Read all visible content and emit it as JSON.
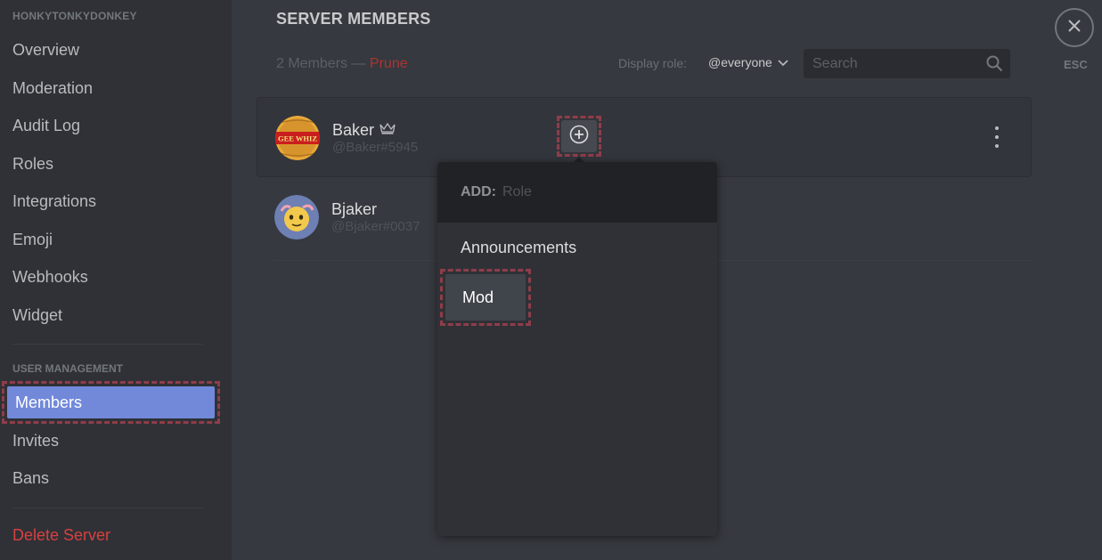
{
  "sidebar": {
    "server_name": "HONKYTONKYDONKEY",
    "items": [
      {
        "label": "Overview"
      },
      {
        "label": "Moderation"
      },
      {
        "label": "Audit Log"
      },
      {
        "label": "Roles"
      },
      {
        "label": "Integrations"
      },
      {
        "label": "Emoji"
      },
      {
        "label": "Webhooks"
      },
      {
        "label": "Widget"
      }
    ],
    "user_management_header": "USER MANAGEMENT",
    "user_management_items": [
      {
        "label": "Members",
        "active": true
      },
      {
        "label": "Invites"
      },
      {
        "label": "Bans"
      }
    ],
    "delete_server": "Delete Server"
  },
  "main": {
    "title": "SERVER MEMBERS",
    "member_count_text": "2 Members —",
    "prune_label": "Prune",
    "display_role_label": "Display role:",
    "display_role_value": "@everyone",
    "search_placeholder": "Search"
  },
  "close": {
    "esc_label": "ESC"
  },
  "members": [
    {
      "name": "Baker",
      "tag": "@Baker#5945",
      "owner": true,
      "avatar_text": "GEE WHIZ"
    },
    {
      "name": "Bjaker",
      "tag": "@Bjaker#0037",
      "owner": false
    }
  ],
  "role_popout": {
    "prefix": "ADD:",
    "placeholder": "Role",
    "roles": [
      {
        "label": "Announcements"
      },
      {
        "label": "Mod"
      }
    ]
  },
  "colors": {
    "accent": "#7289da",
    "danger": "#d84040",
    "highlight_outline": "#8f3d4a"
  }
}
